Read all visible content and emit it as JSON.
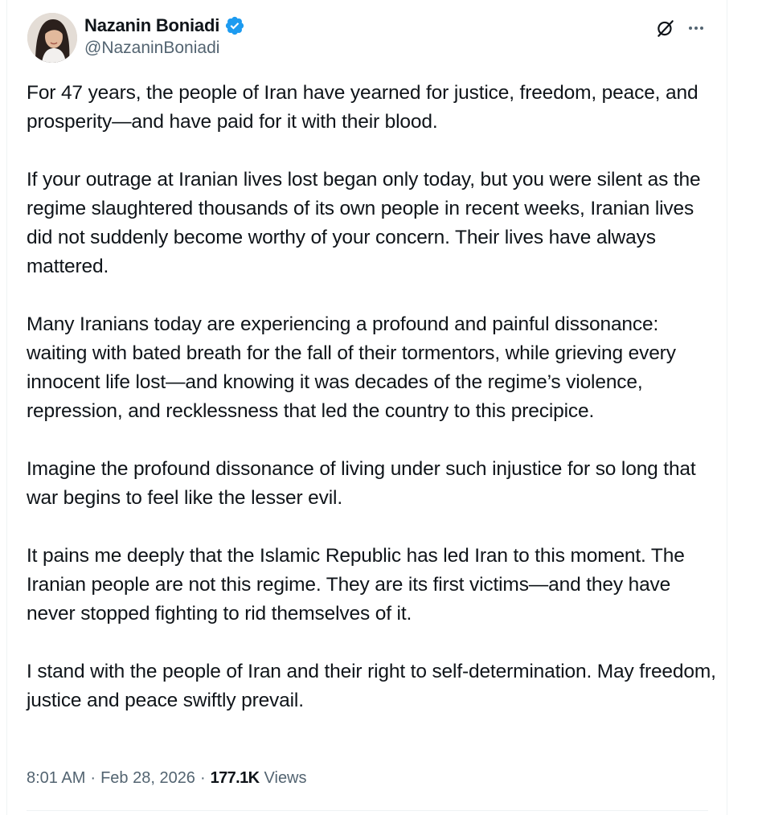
{
  "author": {
    "display_name": "Nazanin Boniadi",
    "handle": "@NazaninBoniadi",
    "verified": true,
    "verified_color": "#1d9bf0",
    "avatar_icon": "profile-photo"
  },
  "actions": {
    "grok_icon": "grok-icon",
    "more_icon": "more-horizontal-icon"
  },
  "tweet": {
    "paragraphs": [
      "For 47 years, the people of Iran have yearned for justice, freedom, peace, and prosperity—and have paid for it with their blood.",
      "If your outrage at Iranian lives lost began only today, but you were silent as the regime slaughtered thousands of its own people in recent weeks, Iranian lives did not suddenly become worthy of your concern. Their lives have always mattered.",
      "Many Iranians today are experiencing a profound and painful dissonance: waiting with bated breath for the fall of their tormentors, while grieving every innocent life lost—and knowing it was decades of the regime’s violence, repression, and recklessness that led the country to this precipice.",
      "Imagine the profound dissonance of living under such injustice for so long that war begins to feel like the lesser evil.",
      "It pains me deeply that the Islamic Republic has led Iran to this moment. The Iranian people are not this regime. They are its first victims—and they have never stopped fighting to rid themselves of it.",
      "I stand with the people of Iran and their right to self-determination. May freedom, justice and peace swiftly prevail."
    ]
  },
  "meta": {
    "time": "8:01 AM",
    "separator": "·",
    "date": "Feb 28, 2026",
    "views_count": "177.1K",
    "views_label": "Views"
  },
  "colors": {
    "text_primary": "#0f1419",
    "text_secondary": "#536471",
    "border": "#eff3f4"
  }
}
